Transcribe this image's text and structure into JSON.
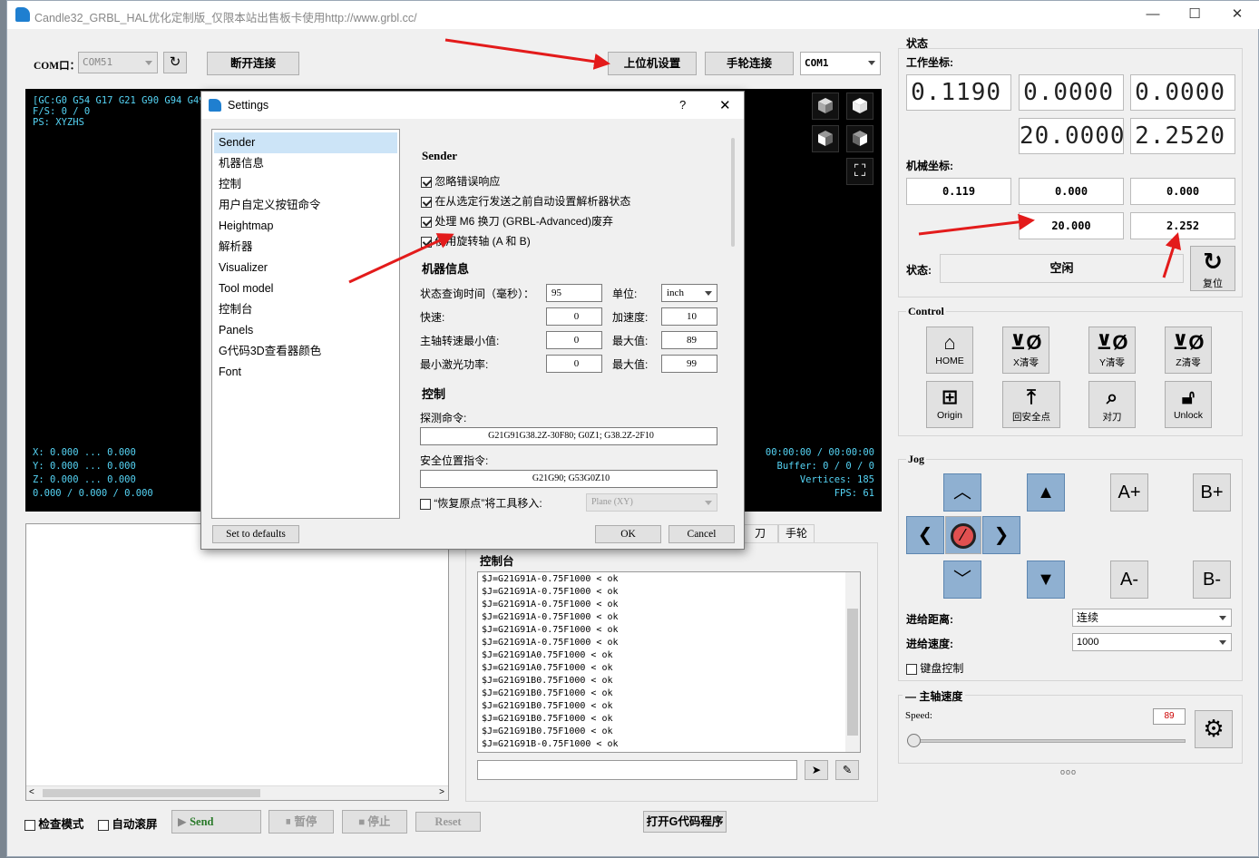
{
  "window": {
    "title": "Candle32_GRBL_HAL优化定制版_仅限本站出售板卡使用http://www.grbl.cc/",
    "minimize": "—",
    "maximize": "☐",
    "close": "✕"
  },
  "top": {
    "com_label": "COM口：",
    "com_value": "COM51",
    "disconnect": "断开连接",
    "host_settings": "上位机设置",
    "handwheel_connect": "手轮连接",
    "com2_value": "COM1"
  },
  "viewer": {
    "gc_line": "[GC:G0 G54 G17 G21 G90 G94 G49",
    "fs_line": "F/S: 0 / 0",
    "ps_line": "PS: XYZHS",
    "coords": [
      "X: 0.000 ... 0.000",
      "Y: 0.000 ... 0.000",
      "Z: 0.000 ... 0.000",
      "0.000 / 0.000 / 0.000"
    ],
    "stats": [
      "00:00:00 / 00:00:00",
      "Buffer: 0 / 0 / 0",
      "Vertices: 185",
      "FPS: 61"
    ]
  },
  "settings_dialog": {
    "title": "Settings",
    "help": "?",
    "close": "✕",
    "nav": [
      "Sender",
      "机器信息",
      "控制",
      "用户自定义按钮命令",
      "Heightmap",
      "解析器",
      "Visualizer",
      "Tool model",
      "控制台",
      "Panels",
      "G代码3D查看器颜色",
      "Font"
    ],
    "sender_title": "Sender",
    "checks": [
      "忽略错误响应",
      "在从选定行发送之前自动设置解析器状态",
      "处理 M6 换刀 (GRBL-Advanced)废弃",
      "使用旋转轴 (A 和 B)"
    ],
    "machine_title": "机器信息",
    "status_query_label": "状态查询时间（毫秒）：",
    "status_query_value": "95",
    "unit_label": "单位:",
    "unit_value": "inch",
    "rapid_label": "快速:",
    "rapid_value": "0",
    "accel_label": "加速度:",
    "accel_value": "10",
    "spindle_min_label": "主轴转速最小值:",
    "spindle_min_value": "0",
    "spindle_max_label": "最大值:",
    "spindle_max_value": "89",
    "laser_min_label": "最小激光功率:",
    "laser_min_value": "0",
    "laser_max_label": "最大值:",
    "laser_max_value": "99",
    "control_title": "控制",
    "probe_label": "探测命令:",
    "probe_value": "G21G91G38.2Z-30F80; G0Z1; G38.2Z-2F10",
    "safe_label": "安全位置指令:",
    "safe_value": "G21G90; G53G0Z10",
    "restore_label": "“恢复原点”将工具移入:",
    "restore_value": "Plane (XY)",
    "defaults": "Set to defaults",
    "ok": "OK",
    "cancel": "Cancel"
  },
  "console": {
    "title": "控制台",
    "tabs": [
      "刀",
      "手轮"
    ],
    "lines": [
      "$J=G21G91A-0.75F1000 < ok",
      "$J=G21G91A-0.75F1000 < ok",
      "$J=G21G91A-0.75F1000 < ok",
      "$J=G21G91A-0.75F1000 < ok",
      "$J=G21G91A-0.75F1000 < ok",
      "$J=G21G91A-0.75F1000 < ok",
      "$J=G21G91A0.75F1000 < ok",
      "$J=G21G91A0.75F1000 < ok",
      "$J=G21G91B0.75F1000 < ok",
      "$J=G21G91B0.75F1000 < ok",
      "$J=G21G91B0.75F1000 < ok",
      "$J=G21G91B0.75F1000 < ok",
      "$J=G21G91B0.75F1000 < ok",
      "$J=G21G91B-0.75F1000 < ok"
    ]
  },
  "bottom": {
    "check_mode": "检查模式",
    "auto_scroll": "自动滚屏",
    "send": "Send",
    "pause": "暂停",
    "stop": "停止",
    "reset": "Reset",
    "open_gcode": "打开G代码程序"
  },
  "state": {
    "title": "状态",
    "work_label": "工作坐标:",
    "work": [
      "0.1190",
      "0.0000",
      "0.0000",
      "20.0000",
      "2.2520"
    ],
    "machine_label": "机械坐标:",
    "machine": [
      "0.119",
      "0.000",
      "0.000",
      "20.000",
      "2.252"
    ],
    "status_label": "状态:",
    "status_value": "空闲",
    "reset_label": "复位"
  },
  "control": {
    "title": "Control",
    "buttons": [
      "HOME",
      "X清零",
      "Y清零",
      "Z清零",
      "Origin",
      "回安全点",
      "对刀",
      "Unlock"
    ]
  },
  "jog": {
    "title": "Jog",
    "a_plus": "A+",
    "b_plus": "B+",
    "a_minus": "A-",
    "b_minus": "B-",
    "dist_label": "进给距离:",
    "dist_value": "连续",
    "speed_label": "进给速度:",
    "speed_value": "1000",
    "keyboard": "键盘控制"
  },
  "spindle": {
    "title": "主轴速度",
    "speed_label": "Speed:",
    "speed_value": "89",
    "dots": "ooo"
  },
  "colors": {
    "accent": "#8fb0d1",
    "arrow": "#e31b1b",
    "terminal": "#55d4f5",
    "stop": "#e05050"
  }
}
